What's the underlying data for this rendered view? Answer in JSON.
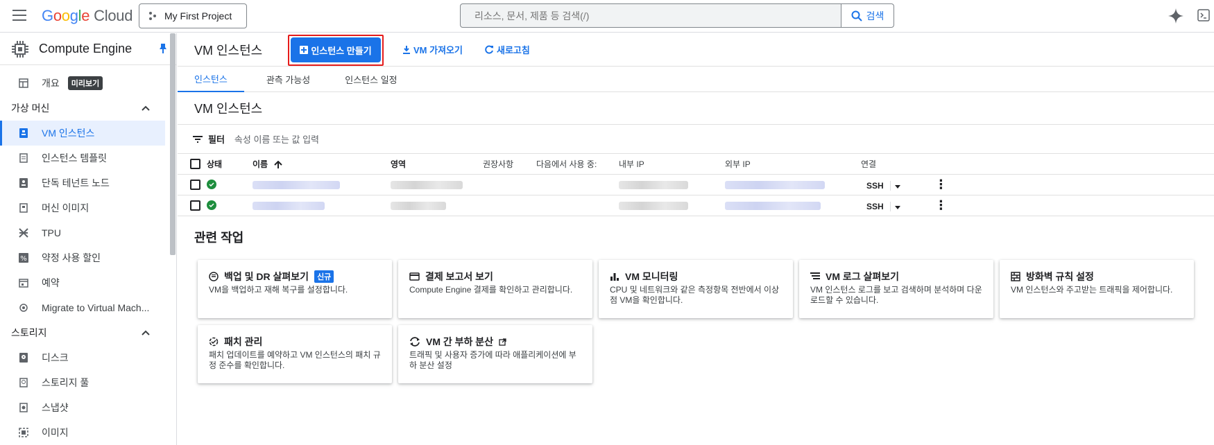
{
  "topbar": {
    "logo_google": "Google",
    "logo_cloud": "Cloud",
    "project": "My First Project",
    "search_placeholder": "리소스, 문서, 제품 등 검색(/)",
    "search_button": "검색"
  },
  "sidebar": {
    "title": "Compute Engine",
    "overview": "개요",
    "overview_badge": "미리보기",
    "vm_section": "가상 머신",
    "vm_items": [
      "VM 인스턴스",
      "인스턴스 템플릿",
      "단독 테넌트 노드",
      "머신 이미지",
      "TPU",
      "약정 사용 할인",
      "예약",
      "Migrate to Virtual Mach..."
    ],
    "storage_section": "스토리지",
    "storage_items": [
      "디스크",
      "스토리지 풀",
      "스냅샷",
      "이미지"
    ]
  },
  "header": {
    "title": "VM 인스턴스",
    "create_button": "인스턴스 만들기",
    "import_button": "VM 가져오기",
    "refresh_button": "새로고침"
  },
  "tabs": [
    "인스턴스",
    "관측 가능성",
    "인스턴스 일정"
  ],
  "section_title": "VM 인스턴스",
  "filter": {
    "label": "필터",
    "placeholder": "속성 이름 또는 값 입력"
  },
  "table": {
    "columns": [
      "상태",
      "이름",
      "영역",
      "권장사항",
      "다음에서 사용 중:",
      "내부 IP",
      "외부 IP",
      "연결"
    ],
    "rows": [
      {
        "connect": "SSH"
      },
      {
        "connect": "SSH"
      }
    ]
  },
  "related": {
    "title": "관련 작업",
    "cards": [
      {
        "title": "백업 및 DR 살펴보기",
        "badge": "신규",
        "desc": "VM을 백업하고 재해 복구를 설정합니다."
      },
      {
        "title": "결제 보고서 보기",
        "desc": "Compute Engine 결제를 확인하고 관리합니다."
      },
      {
        "title": "VM 모니터링",
        "desc": "CPU 및 네트워크와 같은 측정항목 전반에서 이상점 VM을 확인합니다."
      },
      {
        "title": "VM 로그 살펴보기",
        "desc": "VM 인스턴스 로그를 보고 검색하며 분석하며 다운로드할 수 있습니다."
      },
      {
        "title": "방화벽 규칙 설정",
        "desc": "VM 인스턴스와 주고받는 트래픽을 제어합니다."
      },
      {
        "title": "패치 관리",
        "desc": "패치 업데이트를 예약하고 VM 인스턴스의 패치 규정 준수를 확인합니다."
      },
      {
        "title": "VM 간 부하 분산",
        "desc": "트래픽 및 사용자 증가에 따라 애플리케이션에 부하 분산 설정"
      }
    ]
  },
  "colors": {
    "accent": "#1a73e8",
    "highlight": "#e51b1b",
    "status_ok": "#1e8e3e"
  }
}
